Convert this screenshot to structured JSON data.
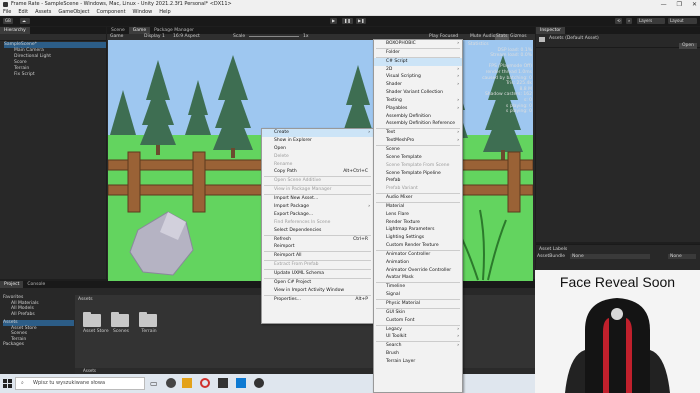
{
  "window": {
    "title": "Frame Rate - SampleScene - Windows, Mac, Linux - Unity 2021.2.3f1 Personal* <DX11>",
    "buttons": [
      "—",
      "❐",
      "✕"
    ]
  },
  "menubar": [
    "File",
    "Edit",
    "Assets",
    "GameObject",
    "Component",
    "Window",
    "Help"
  ],
  "toolbar": {
    "account": "GB",
    "layers": "Layers",
    "layout": "Layout"
  },
  "hierarchy": {
    "tab": "Hierarchy",
    "items": [
      "SampleScene*",
      "Main Camera",
      "Directional Light",
      "Score",
      "Terrain",
      "Fix Script"
    ]
  },
  "center_tabs": [
    "Scene",
    "Game",
    "Package Manager"
  ],
  "game_bar": {
    "display": "Game",
    "display_num": "Display 1",
    "aspect": "16:9 Aspect",
    "scale_label": "Scale",
    "scale_value": "1x",
    "play_focused": "Play Focused",
    "mute": "Mute Audio",
    "stats": "Stats",
    "gizmos": "Gizmos"
  },
  "stats_overlay": {
    "title": "Statistics",
    "lines": [
      "DSP load: 0.1%",
      "Stream load: 0.0%",
      "",
      "FPS (Playmode Off)",
      "render thread 1.0ms",
      "caused by batching: 0",
      "Tris: 225.4k",
      "8.8 M",
      "Shadow casters: 162",
      "s: 0",
      "s playing: 0",
      "s playing: 0"
    ]
  },
  "context_menu": {
    "items": [
      {
        "label": "Create",
        "arrow": true,
        "highlight": true
      },
      {
        "label": "Show in Explorer"
      },
      {
        "label": "Open"
      },
      {
        "label": "Delete",
        "disabled": true
      },
      {
        "label": "Rename",
        "disabled": true
      },
      {
        "label": "Copy Path",
        "shortcut": "Alt+Ctrl+C"
      },
      {
        "sep": true
      },
      {
        "label": "Open Scene Additive",
        "disabled": true
      },
      {
        "sep": true
      },
      {
        "label": "View in Package Manager",
        "disabled": true
      },
      {
        "sep": true
      },
      {
        "label": "Import New Asset..."
      },
      {
        "label": "Import Package",
        "arrow": true
      },
      {
        "label": "Export Package..."
      },
      {
        "label": "Find References In Scene",
        "disabled": true
      },
      {
        "label": "Select Dependencies"
      },
      {
        "sep": true
      },
      {
        "label": "Refresh",
        "shortcut": "Ctrl+R"
      },
      {
        "label": "Reimport"
      },
      {
        "sep": true
      },
      {
        "label": "Reimport All"
      },
      {
        "sep": true
      },
      {
        "label": "Extract From Prefab",
        "disabled": true
      },
      {
        "sep": true
      },
      {
        "label": "Update UXML Schema"
      },
      {
        "sep": true
      },
      {
        "label": "Open C# Project"
      },
      {
        "label": "View in Import Activity Window"
      },
      {
        "sep": true
      },
      {
        "label": "Properties...",
        "shortcut": "Alt+P"
      }
    ]
  },
  "create_submenu": {
    "items": [
      {
        "label": "BOXOPHOBIC",
        "arrow": true
      },
      {
        "sep": true
      },
      {
        "label": "Folder"
      },
      {
        "sep": true
      },
      {
        "label": "C# Script",
        "highlight": true
      },
      {
        "label": "2D",
        "arrow": true
      },
      {
        "label": "Visual Scripting",
        "arrow": true
      },
      {
        "label": "Shader",
        "arrow": true
      },
      {
        "label": "Shader Variant Collection"
      },
      {
        "label": "Testing",
        "arrow": true
      },
      {
        "label": "Playables",
        "arrow": true
      },
      {
        "label": "Assembly Definition"
      },
      {
        "label": "Assembly Definition Reference"
      },
      {
        "sep": true
      },
      {
        "label": "Text",
        "arrow": true
      },
      {
        "label": "TextMeshPro",
        "arrow": true
      },
      {
        "sep": true
      },
      {
        "label": "Scene"
      },
      {
        "label": "Scene Template"
      },
      {
        "label": "Scene Template From Scene",
        "disabled": true
      },
      {
        "label": "Scene Template Pipeline"
      },
      {
        "label": "Prefab"
      },
      {
        "label": "Prefab Variant",
        "disabled": true
      },
      {
        "sep": true
      },
      {
        "label": "Audio Mixer"
      },
      {
        "sep": true
      },
      {
        "label": "Material"
      },
      {
        "label": "Lens Flare"
      },
      {
        "label": "Render Texture"
      },
      {
        "label": "Lightmap Parameters"
      },
      {
        "label": "Lighting Settings"
      },
      {
        "label": "Custom Render Texture"
      },
      {
        "sep": true
      },
      {
        "label": "Animator Controller"
      },
      {
        "label": "Animation"
      },
      {
        "label": "Animator Override Controller"
      },
      {
        "label": "Avatar Mask"
      },
      {
        "sep": true
      },
      {
        "label": "Timeline"
      },
      {
        "label": "Signal"
      },
      {
        "sep": true
      },
      {
        "label": "Physic Material"
      },
      {
        "sep": true
      },
      {
        "label": "GUI Skin"
      },
      {
        "label": "Custom Font"
      },
      {
        "sep": true
      },
      {
        "label": "Legacy",
        "arrow": true
      },
      {
        "label": "UI Toolkit",
        "arrow": true
      },
      {
        "sep": true
      },
      {
        "label": "Search",
        "arrow": true
      },
      {
        "label": "Brush"
      },
      {
        "label": "Terrain Layer"
      }
    ]
  },
  "inspector": {
    "tab": "Inspector",
    "title": "Assets (Default Asset)",
    "open_btn": "Open"
  },
  "asset_labels": {
    "title": "Asset Labels",
    "bundle": "AssetBundle",
    "none1": "None",
    "none2": "None"
  },
  "project": {
    "tabs": [
      "Project",
      "Console"
    ],
    "favorites": [
      "Favorites",
      "All Materials",
      "All Models",
      "All Prefabs"
    ],
    "assets_tree": [
      "Assets",
      "Asset Store",
      "Scenes",
      "Terrain"
    ],
    "packages": "Packages",
    "breadcrumb": "Assets",
    "folders": [
      "Asset Store",
      "Scenes",
      "Terrain"
    ],
    "footer": "Assets"
  },
  "taskbar": {
    "search_placeholder": "Wpisz tu wyszukiwane słowa"
  },
  "facecam": {
    "text": "Face Reveal Soon"
  },
  "colors": {
    "sky": "#9ec7f0",
    "grass": "#63d45f",
    "fence": "#8a5a32",
    "highlight": "#cce4f7"
  }
}
